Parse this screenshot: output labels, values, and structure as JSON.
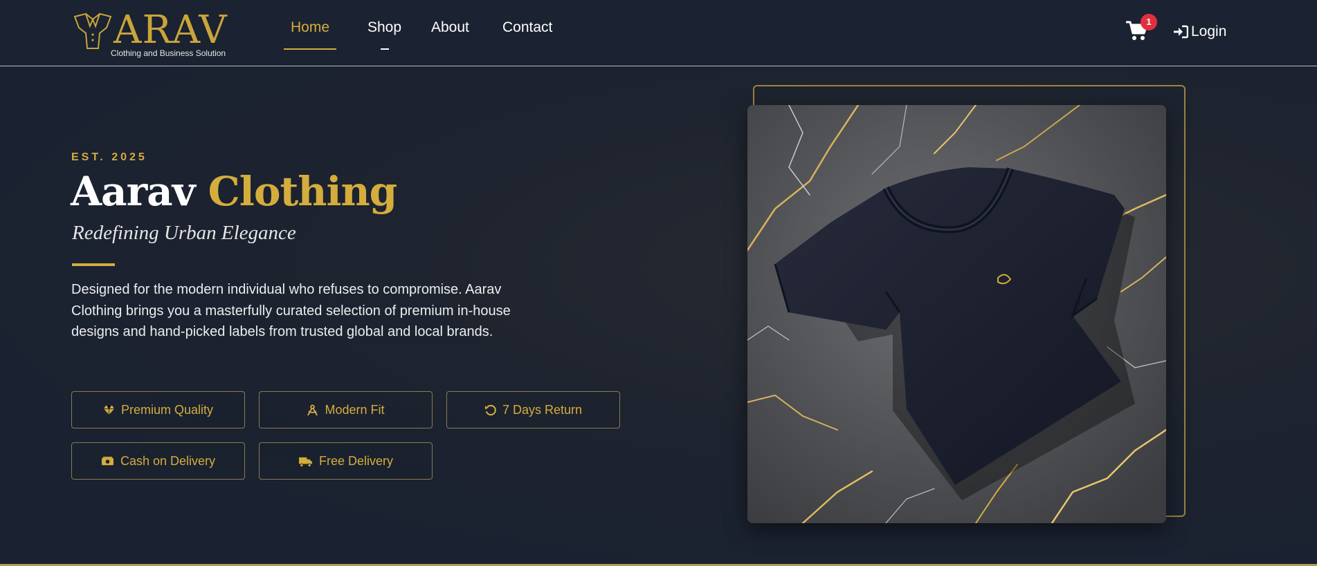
{
  "brand": {
    "name": "ARAV",
    "tagline": "Clothing and Business Solution",
    "gold": "#d4ad3d"
  },
  "nav": {
    "items": [
      {
        "label": "Home",
        "active": true
      },
      {
        "label": "Shop",
        "active": false
      },
      {
        "label": "About",
        "active": false
      },
      {
        "label": "Contact",
        "active": false
      }
    ]
  },
  "header": {
    "cart_icon": "shopping-cart-icon",
    "cart_count": "1",
    "login_icon": "sign-in-icon",
    "login_label": "Login"
  },
  "hero": {
    "eyebrow": "EST. 2025",
    "title_main": "Aarav",
    "title_accent": "Clothing",
    "subtitle": "Redefining Urban Elegance",
    "description": "Designed for the modern individual who refuses to compromise. Aarav Clothing brings you a masterfully curated selection of premium in-house designs and hand-picked labels from trusted global and local brands.",
    "image_icon": "black-tshirt-on-marble-image"
  },
  "features": [
    {
      "label": "Premium Quality",
      "icon": "gem-icon"
    },
    {
      "label": "Modern Fit",
      "icon": "compass-icon"
    },
    {
      "label": "7 Days Return",
      "icon": "undo-icon"
    },
    {
      "label": "Cash on Delivery",
      "icon": "money-bill-icon"
    },
    {
      "label": "Free Delivery",
      "icon": "truck-icon"
    }
  ]
}
